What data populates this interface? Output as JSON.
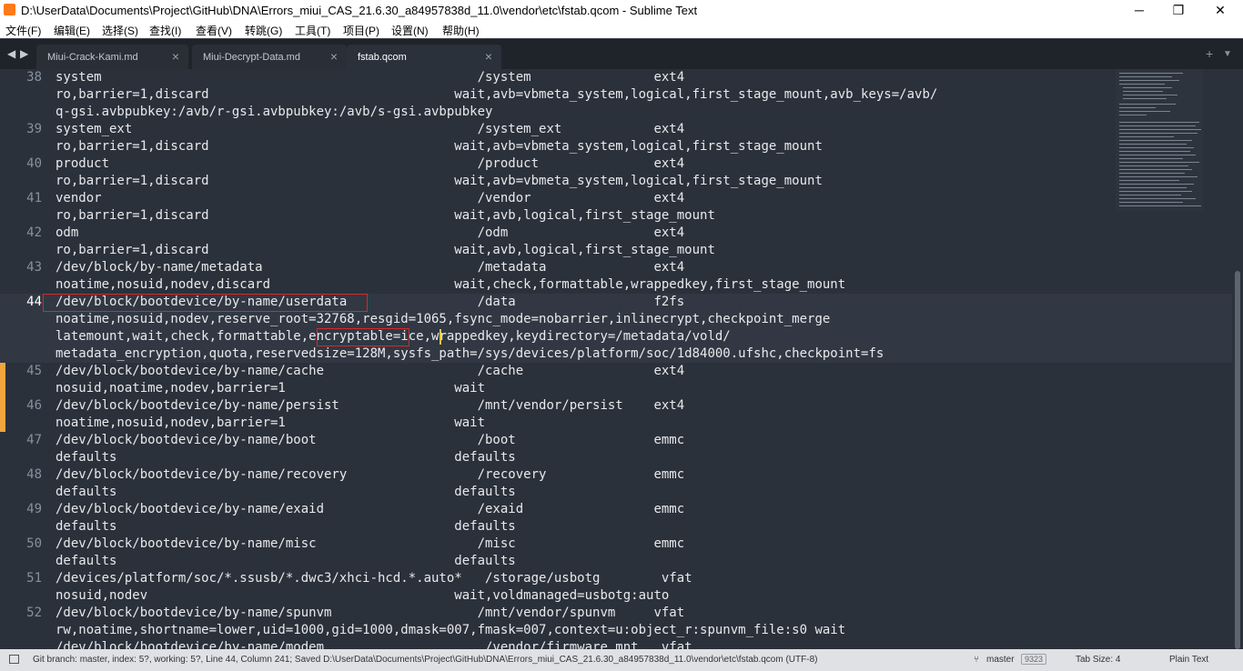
{
  "window": {
    "title": "D:\\UserData\\Documents\\Project\\GitHub\\DNA\\Errors_miui_CAS_21.6.30_a84957838d_11.0\\vendor\\etc\\fstab.qcom - Sublime Text",
    "minimize": "─",
    "maximize": "❐",
    "close": "✕"
  },
  "menu": [
    "文件(F)",
    "编辑(E)",
    "选择(S)",
    "查找(I)",
    "查看(V)",
    "转跳(G)",
    "工具(T)",
    "项目(P)",
    "设置(N)",
    "帮助(H)"
  ],
  "tabs": {
    "nav_left": "◀",
    "nav_right": "▶",
    "items": [
      {
        "label": "Miui-Crack-Kami.md",
        "close": "×"
      },
      {
        "label": "Miui-Decrypt-Data.md",
        "close": "×"
      },
      {
        "label": "fstab.qcom",
        "close": "×"
      }
    ],
    "new_tab": "+",
    "dropdown": "▼"
  },
  "editor": {
    "lines": [
      {
        "num": "38",
        "rows": [
          "system                                                 /system                ext4",
          "ro,barrier=1,discard                                wait,avb=vbmeta_system,logical,first_stage_mount,avb_keys=/avb/",
          "q-gsi.avbpubkey:/avb/r-gsi.avbpubkey:/avb/s-gsi.avbpubkey"
        ]
      },
      {
        "num": "39",
        "rows": [
          "system_ext                                             /system_ext            ext4",
          "ro,barrier=1,discard                                wait,avb=vbmeta_system,logical,first_stage_mount"
        ]
      },
      {
        "num": "40",
        "rows": [
          "product                                                /product               ext4",
          "ro,barrier=1,discard                                wait,avb=vbmeta_system,logical,first_stage_mount"
        ]
      },
      {
        "num": "41",
        "rows": [
          "vendor                                                 /vendor                ext4",
          "ro,barrier=1,discard                                wait,avb,logical,first_stage_mount"
        ]
      },
      {
        "num": "42",
        "rows": [
          "odm                                                    /odm                   ext4",
          "ro,barrier=1,discard                                wait,avb,logical,first_stage_mount"
        ]
      },
      {
        "num": "43",
        "rows": [
          "/dev/block/by-name/metadata                            /metadata              ext4",
          "noatime,nosuid,nodev,discard                        wait,check,formattable,wrappedkey,first_stage_mount"
        ]
      },
      {
        "num": "44",
        "rows": [
          "/dev/block/bootdevice/by-name/userdata                 /data                  f2fs",
          "noatime,nosuid,nodev,reserve_root=32768,resgid=1065,fsync_mode=nobarrier,inlinecrypt,checkpoint_merge",
          "latemount,wait,check,formattable,encryptable=ice,wrappedkey,keydirectory=/metadata/vold/",
          "metadata_encryption,quota,reservedsize=128M,sysfs_path=/sys/devices/platform/soc/1d84000.ufshc,checkpoint=fs"
        ]
      },
      {
        "num": "45",
        "rows": [
          "/dev/block/bootdevice/by-name/cache                    /cache                 ext4",
          "nosuid,noatime,nodev,barrier=1                      wait"
        ]
      },
      {
        "num": "46",
        "rows": [
          "/dev/block/bootdevice/by-name/persist                  /mnt/vendor/persist    ext4",
          "noatime,nosuid,nodev,barrier=1                      wait"
        ]
      },
      {
        "num": "47",
        "rows": [
          "/dev/block/bootdevice/by-name/boot                     /boot                  emmc",
          "defaults                                            defaults"
        ]
      },
      {
        "num": "48",
        "rows": [
          "/dev/block/bootdevice/by-name/recovery                 /recovery              emmc",
          "defaults                                            defaults"
        ]
      },
      {
        "num": "49",
        "rows": [
          "/dev/block/bootdevice/by-name/exaid                    /exaid                 emmc",
          "defaults                                            defaults"
        ]
      },
      {
        "num": "50",
        "rows": [
          "/dev/block/bootdevice/by-name/misc                     /misc                  emmc",
          "defaults                                            defaults"
        ]
      },
      {
        "num": "51",
        "rows": [
          "/devices/platform/soc/*.ssusb/*.dwc3/xhci-hcd.*.auto*   /storage/usbotg        vfat",
          "nosuid,nodev                                        wait,voldmanaged=usbotg:auto"
        ]
      },
      {
        "num": "52",
        "rows": [
          "/dev/block/bootdevice/by-name/spunvm                   /mnt/vendor/spunvm     vfat",
          "rw,noatime,shortname=lower,uid=1000,gid=1000,dmask=007,fmask=007,context=u:object_r:spunvm_file:s0 wait"
        ]
      },
      {
        "num": "",
        "rows": [
          "/dev/block/bootdevice/by-name/modem                     /vendor/firmware_mnt   vfat"
        ]
      }
    ]
  },
  "status": {
    "left": "Git branch: master, index: 5?, working: 5?, Line 44, Column 241; Saved D:\\UserData\\Documents\\Project\\GitHub\\DNA\\Errors_miui_CAS_21.6.30_a84957838d_11.0\\vendor\\etc\\fstab.qcom (UTF-8)",
    "branch": "master",
    "branch_count": "9323",
    "tab_size": "Tab Size: 4",
    "syntax": "Plain Text"
  },
  "colors": {
    "accent": "#f2a53e",
    "annotation": "#d7282a",
    "background": "#2b313b"
  }
}
